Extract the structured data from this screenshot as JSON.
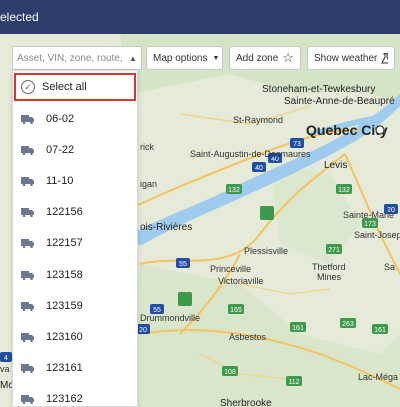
{
  "header": {
    "title": "elected"
  },
  "toolbar": {
    "search_placeholder": "Asset, VIN, zone, route, ...",
    "map_options_label": "Map options",
    "add_zone_label": "Add zone",
    "show_weather_label": "Show weather"
  },
  "dropdown": {
    "select_all_label": "Select all",
    "vehicles": [
      "06-02",
      "07-22",
      "11-10",
      "122156",
      "122157",
      "123158",
      "123159",
      "123160",
      "123161",
      "123162"
    ]
  },
  "map": {
    "places": {
      "stoneham": "Stoneham-et-Tewkesbury",
      "beaupre": "Sainte-Anne-de-Beaupré",
      "straymond": "St-Raymond",
      "quebec": "Quebec City",
      "augustin": "Saint-Augustin-de-Desmaures",
      "levis": "Levis",
      "rivieres": "ois-Rivières",
      "saintemarie": "Sainte-Marie",
      "saintjoseph": "Saint-Joseph-c",
      "plessisville": "Plessisville",
      "princeville": "Princeville",
      "victoriaville": "Victoriaville",
      "thetford": "Thetford",
      "mines": "Mines",
      "drummondville": "Drummondville",
      "asbestos": "Asbestos",
      "lacmega": "Lac-Méga",
      "sherbrooke": "Sherbrooke",
      "rick": "rick",
      "igan": "igan",
      "sa": "Sa"
    },
    "routes": [
      "40",
      "40",
      "73",
      "132",
      "132",
      "173",
      "271",
      "55",
      "55",
      "165",
      "20",
      "161",
      "263",
      "161",
      "112",
      "108",
      "20",
      "4",
      "Mo",
      "va"
    ]
  }
}
